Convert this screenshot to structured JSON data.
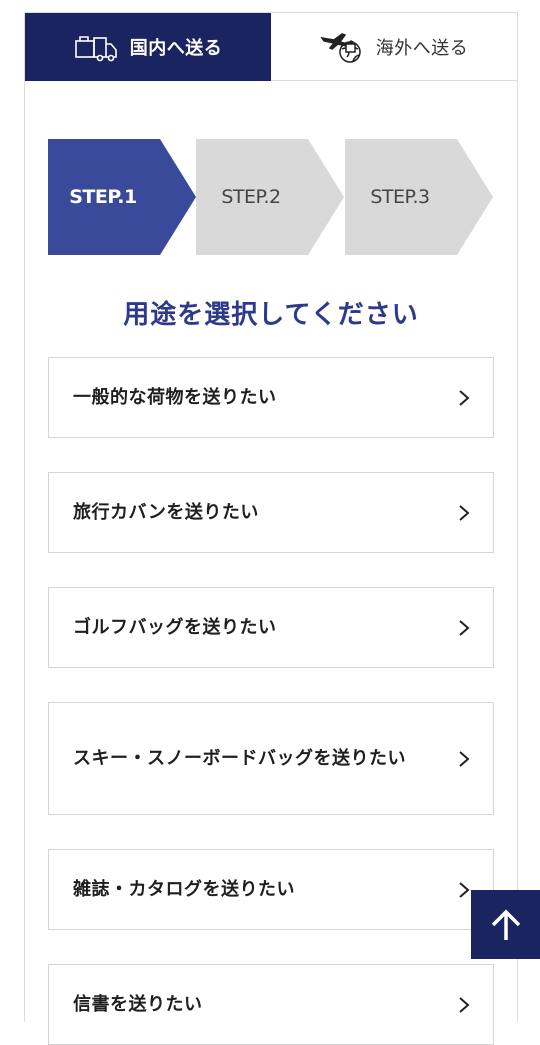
{
  "tabs": [
    {
      "label": "国内へ送る",
      "icon": "truck-box-icon",
      "active": true
    },
    {
      "label": "海外へ送る",
      "icon": "airplane-globe-icon",
      "active": false
    }
  ],
  "steps": [
    {
      "label": "STEP.1",
      "state": "active"
    },
    {
      "label": "STEP.2",
      "state": "pending"
    },
    {
      "label": "STEP.3",
      "state": "pending"
    }
  ],
  "heading": "用途を選択してください",
  "options": [
    {
      "label": "一般的な荷物を送りたい"
    },
    {
      "label": "旅行カバンを送りたい"
    },
    {
      "label": "ゴルフバッグを送りたい"
    },
    {
      "label": "スキー・スノーボードバッグを送りたい"
    },
    {
      "label": "雑誌・カタログを送りたい"
    },
    {
      "label": "信書を送りたい"
    }
  ],
  "colors": {
    "navy": "#1a2460",
    "step_active": "#3a4a9a",
    "step_pending": "#d9d9d9",
    "heading": "#2d3a8c",
    "border": "#d5d5d5"
  },
  "icons": {
    "chevron": "chevron-right-icon",
    "scroll_top": "arrow-up-icon"
  }
}
